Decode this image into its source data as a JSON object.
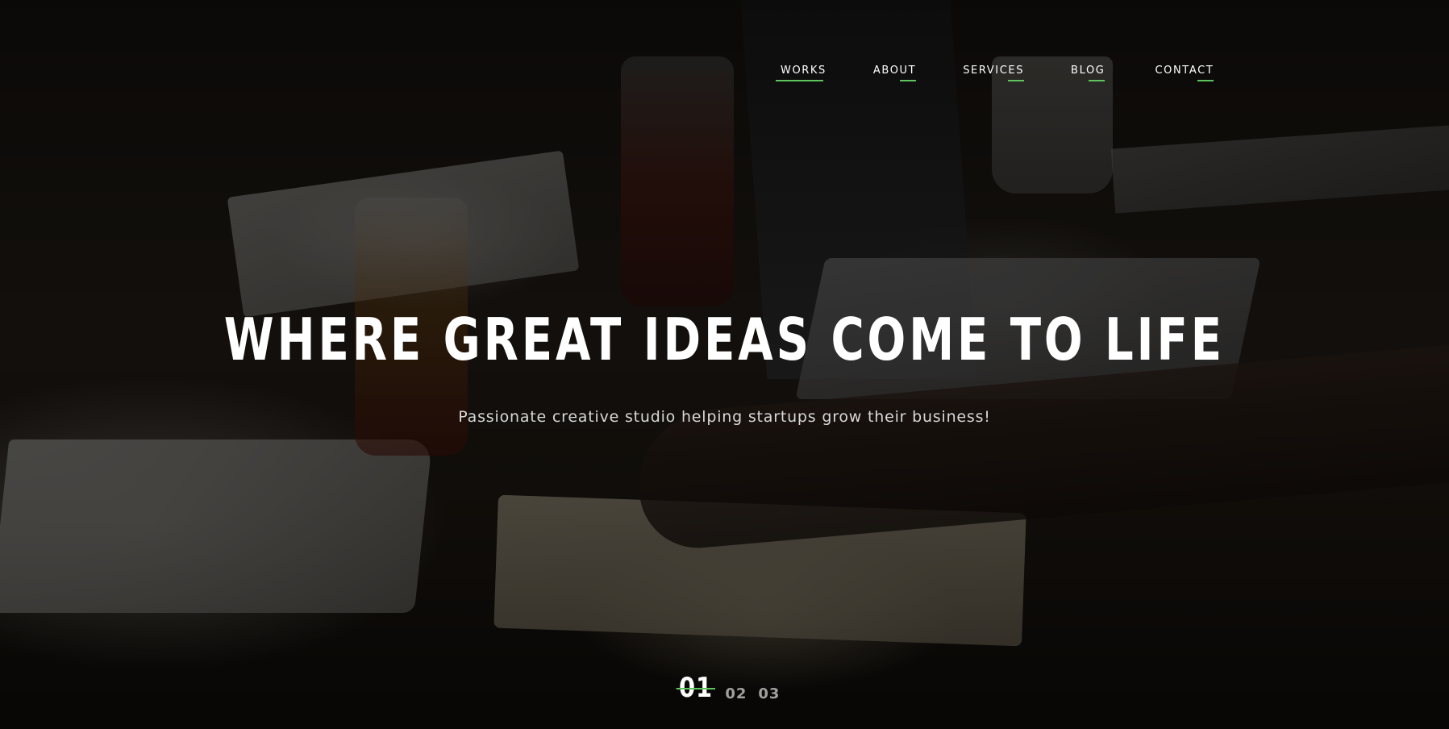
{
  "theme": {
    "accent": "#5ec45e",
    "text": "#ffffff",
    "overlay": "rgba(0,0,0,0.55)"
  },
  "nav": {
    "items": [
      {
        "label": "WORKS",
        "active": true
      },
      {
        "label": "ABOUT",
        "active": false
      },
      {
        "label": "SERVICES",
        "active": false
      },
      {
        "label": "BLOG",
        "active": false
      },
      {
        "label": "CONTACT",
        "active": false
      }
    ]
  },
  "hero": {
    "headline": "WHERE GREAT IDEAS COME TO LIFE",
    "subtitle": "Passionate creative studio helping startups grow their business!"
  },
  "pager": {
    "items": [
      {
        "label": "01",
        "active": true
      },
      {
        "label": "02",
        "active": false
      },
      {
        "label": "03",
        "active": false
      }
    ]
  }
}
